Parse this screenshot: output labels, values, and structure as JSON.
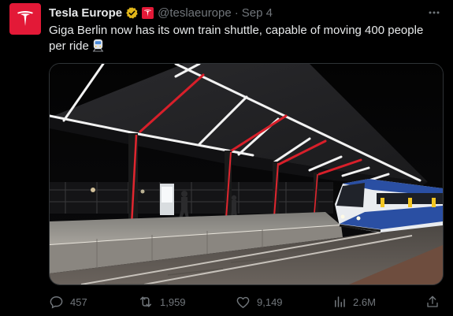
{
  "tweet": {
    "author_name": "Tesla Europe",
    "handle": "@teslaeurope",
    "separator": "·",
    "date": "Sep 4",
    "text": "Giga Berlin now has its own train shuttle, capable of moving 400 people per ride",
    "emoji": "train-emoji"
  },
  "actions": {
    "replies": "457",
    "retweets": "1,959",
    "likes": "9,149",
    "views": "2.6M"
  },
  "icons": {
    "avatar": "tesla-logo-icon",
    "verified": "verified-badge-icon",
    "affiliate": "tesla-affiliate-icon",
    "more": "more-icon",
    "reply": "reply-icon",
    "retweet": "retweet-icon",
    "like": "heart-icon",
    "views": "views-icon",
    "share": "share-icon"
  },
  "colors": {
    "tesla_red": "#e31937",
    "verified_gold": "#e2b719",
    "text": "#e7e9ea",
    "secondary": "#71767b"
  }
}
